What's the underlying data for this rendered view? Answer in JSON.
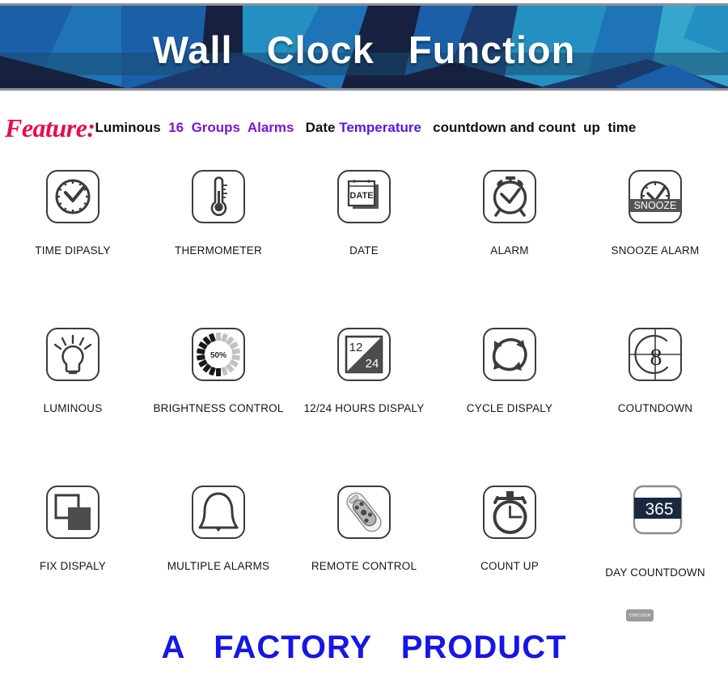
{
  "banner": {
    "title": "Wall   Clock   Function",
    "palette": {
      "navy_dark": "#16213f",
      "navy": "#1b3a6b",
      "blue": "#1b5fa8",
      "blue_mid": "#1f74b8",
      "teal": "#2490c2",
      "cyan": "#37a6cc",
      "band": "#1a4a70",
      "frame": "#8f9099"
    }
  },
  "feature": {
    "label": "Feature:",
    "label_color": "#ee0a4e",
    "segments": [
      {
        "text": "Luminous",
        "color": "black"
      },
      {
        "text": "  16  Groups  Alarms",
        "color": "purple"
      },
      {
        "text": "   Date ",
        "color": "black"
      },
      {
        "text": "Temperature",
        "color": "violet"
      },
      {
        "text": "   countdown and count  up  time",
        "color": "black"
      }
    ]
  },
  "features_grid": {
    "rows": [
      [
        {
          "label": "TIME DIPASLY",
          "icon": "clock-icon"
        },
        {
          "label": "THERMOMETER",
          "icon": "thermometer-icon"
        },
        {
          "label": "DATE",
          "icon": "calendar-icon",
          "inner_text": "DATE"
        },
        {
          "label": "ALARM",
          "icon": "alarm-clock-icon"
        },
        {
          "label": "SNOOZE ALARM",
          "icon": "snooze-icon",
          "inner_text": "SNOOZE"
        }
      ],
      [
        {
          "label": "LUMINOUS",
          "icon": "lightbulb-icon"
        },
        {
          "label": "BRIGHTNESS CONTROL",
          "icon": "brightness-gauge-icon",
          "inner_text": "50%"
        },
        {
          "label": "12/24 HOURS DISPALY",
          "icon": "hour-format-icon",
          "inner_text": "12 / 24"
        },
        {
          "label": "CYCLE DISPALY",
          "icon": "cycle-arrows-icon"
        },
        {
          "label": "COUTNDOWN",
          "icon": "film-countdown-icon",
          "inner_text": "8"
        }
      ],
      [
        {
          "label": "FIX DISPALY",
          "icon": "overlapping-squares-icon"
        },
        {
          "label": "MULTIPLE ALARMS",
          "icon": "bell-icon"
        },
        {
          "label": "REMOTE CONTROL",
          "icon": "remote-control-icon"
        },
        {
          "label": "COUNT UP",
          "icon": "stopwatch-icon"
        },
        {
          "label": "DAY COUNTDOWN",
          "icon": "day-counter-icon",
          "inner_text": "365"
        }
      ]
    ]
  },
  "footer": {
    "text": "A   FACTORY   PRODUCT",
    "color": "#1616e8",
    "watermark": "CHKOSDA"
  }
}
